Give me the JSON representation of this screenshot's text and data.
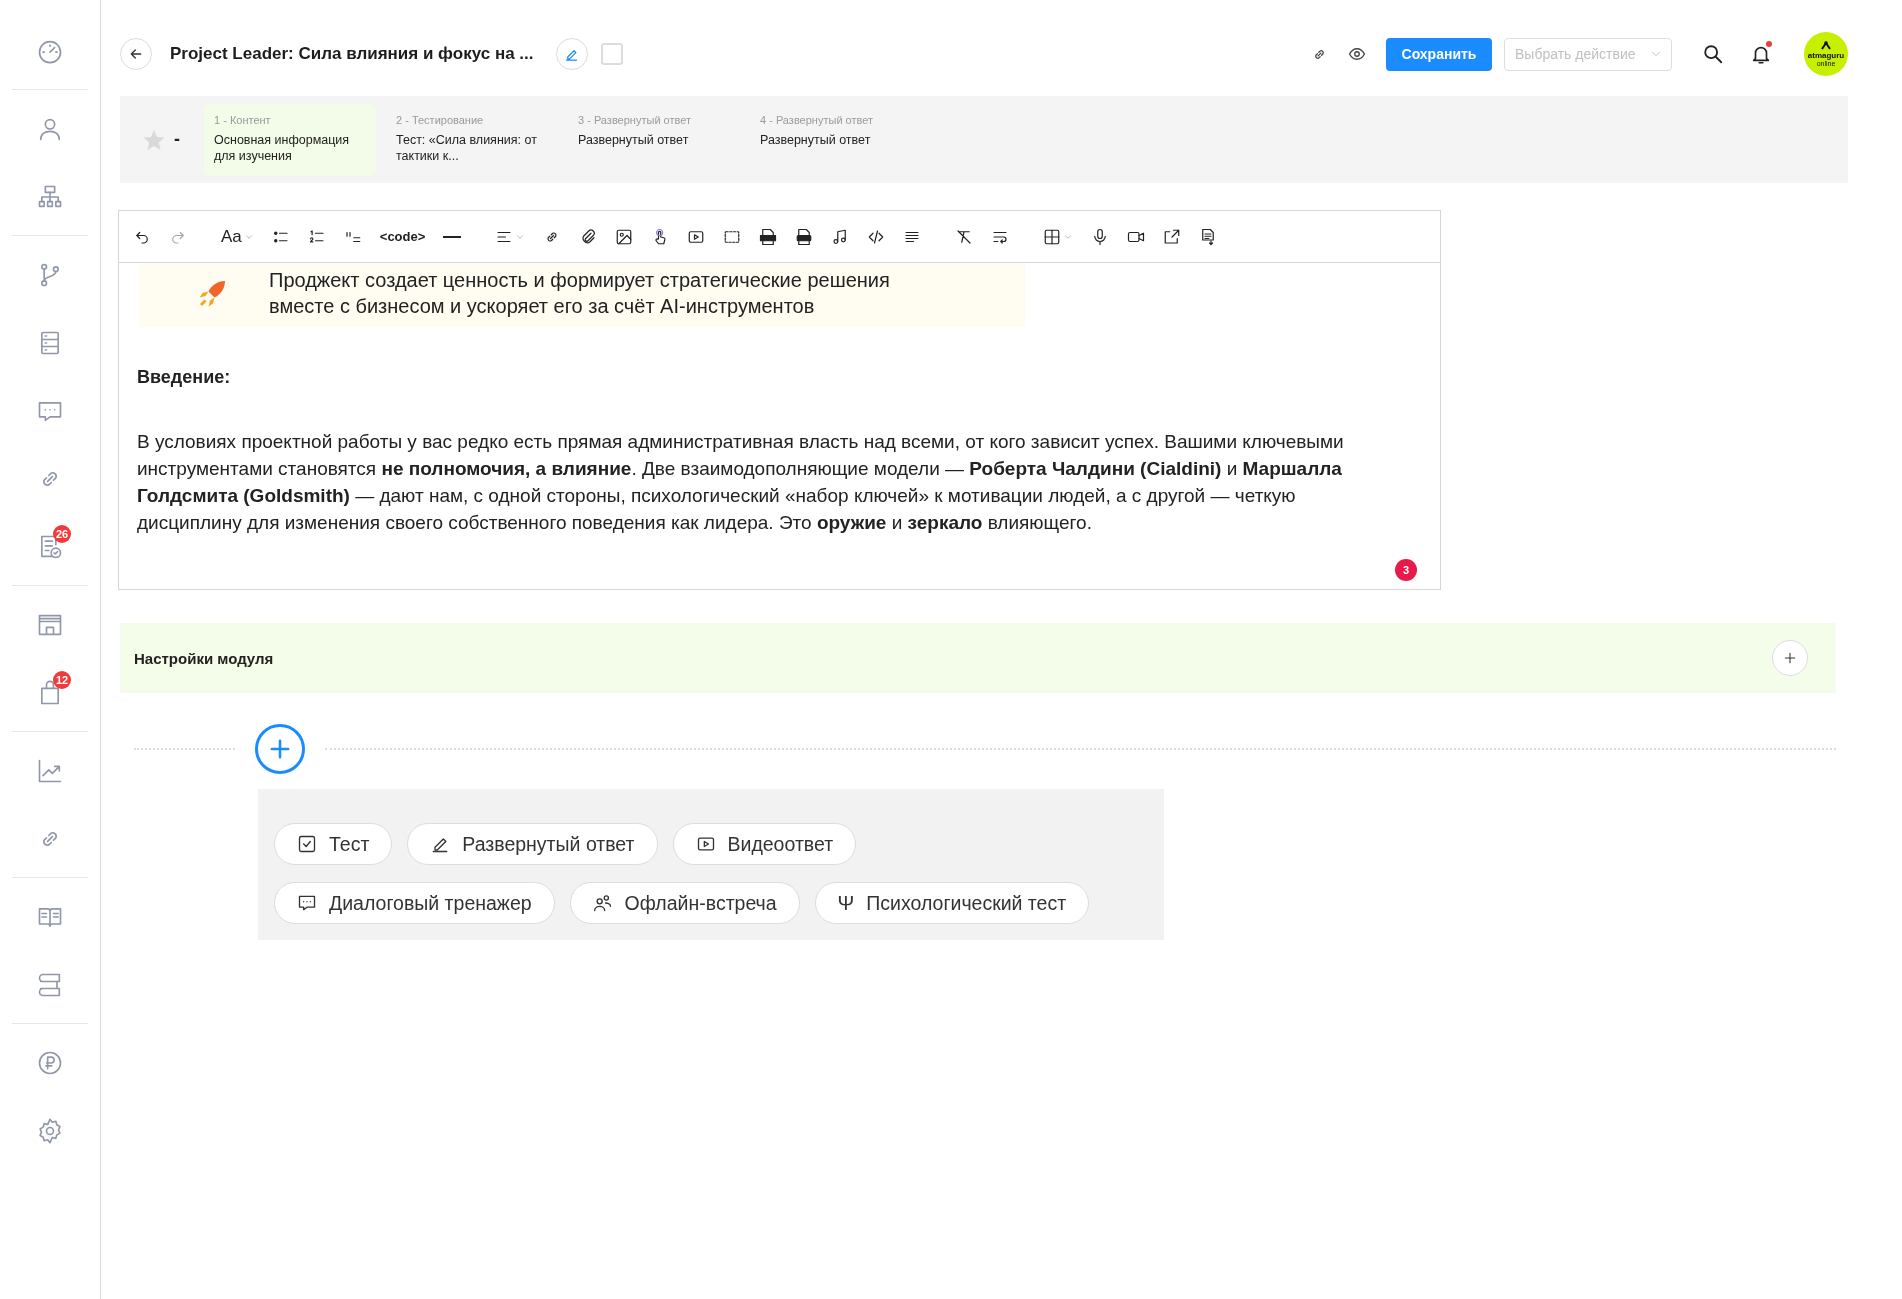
{
  "sidebar": {
    "groups": [
      [
        {
          "kind": "dashboard"
        }
      ],
      [
        {
          "kind": "user"
        },
        {
          "kind": "org"
        }
      ],
      [
        {
          "kind": "branch"
        },
        {
          "kind": "list"
        },
        {
          "kind": "chat"
        },
        {
          "kind": "link"
        },
        {
          "kind": "tasks",
          "badge": "26"
        }
      ],
      [
        {
          "kind": "store"
        },
        {
          "kind": "bag",
          "badge": "12"
        }
      ],
      [
        {
          "kind": "chart"
        },
        {
          "kind": "link"
        }
      ],
      [
        {
          "kind": "book"
        },
        {
          "kind": "stack"
        }
      ],
      [
        {
          "kind": "ruble"
        },
        {
          "kind": "settings"
        }
      ]
    ]
  },
  "header": {
    "title": "Project Leader: Сила влияния и фокус на ...",
    "checkbox": {
      "checked": false
    },
    "save_button": "Сохранить",
    "action_select": {
      "placeholder": "Выбрать действие"
    },
    "notifications": {
      "unread": true
    },
    "logo": {
      "text": "atmaguru",
      "subtext": "online"
    }
  },
  "steps": {
    "rating": {
      "starred": false,
      "value": "-"
    },
    "items": [
      {
        "label": "1 - Контент",
        "title": "Основная информация для изучения",
        "selected": true
      },
      {
        "label": "2 - Тестирование",
        "title": "Тест: «Сила влияния: от тактики к...",
        "selected": false
      },
      {
        "label": "3 - Развернутый ответ",
        "title": "Развернутый ответ",
        "selected": false
      },
      {
        "label": "4 - Развернутый ответ",
        "title": "Развернутый ответ",
        "selected": false
      }
    ]
  },
  "editor": {
    "toolbar": {
      "groups": [
        [
          {
            "kind": "undo",
            "disabled": false
          },
          {
            "kind": "redo",
            "disabled": true
          }
        ],
        [
          {
            "kind": "font",
            "label": "Aa",
            "disabled": false
          },
          {
            "kind": "bullets",
            "disabled": false
          },
          {
            "kind": "numbered",
            "disabled": false
          },
          {
            "kind": "quote",
            "disabled": false
          },
          {
            "kind": "code",
            "label": "<code>",
            "disabled": false
          },
          {
            "kind": "hr",
            "disabled": false
          }
        ],
        [
          {
            "kind": "align",
            "disabled": false
          },
          {
            "kind": "link",
            "disabled": false
          },
          {
            "kind": "clip",
            "disabled": false
          },
          {
            "kind": "image",
            "disabled": false
          },
          {
            "kind": "touch",
            "disabled": false
          },
          {
            "kind": "video",
            "disabled": false
          },
          {
            "kind": "select",
            "disabled": false
          },
          {
            "kind": "pptx",
            "disabled": false
          },
          {
            "kind": "pdf",
            "disabled": false
          },
          {
            "kind": "music",
            "disabled": false
          },
          {
            "kind": "embed",
            "disabled": false
          },
          {
            "kind": "more",
            "disabled": false
          }
        ],
        [
          {
            "kind": "clear",
            "disabled": false
          },
          {
            "kind": "wrap",
            "disabled": false
          }
        ],
        [
          {
            "kind": "table",
            "disabled": false
          },
          {
            "kind": "mic",
            "disabled": false
          },
          {
            "kind": "camera",
            "disabled": false
          },
          {
            "kind": "export",
            "disabled": false
          },
          {
            "kind": "doc",
            "disabled": false
          }
        ]
      ]
    },
    "content": {
      "callout": "Проджект создает ценность и формирует стратегические решения вместе с бизнесом и ускоряет его за счёт AI-инструментов",
      "heading": "Введение:",
      "paragraph": "В условиях проектной работы у вас редко есть прямая административная власть над всеми, от кого зависит успех. Вашими ключевыми инструментами становятся **не полномочия, а влияние**. Две взаимодополняющие модели — **Роберта Чалдини (Cialdini)** и **Маршалла Голдсмита (Goldsmith)** — дают нам, с одной стороны, психологический «набор ключей» к мотивации людей, а с другой — четкую дисциплину для изменения своего собственного поведения как лидера. Это **оружие** и **зеркало** влияющего."
    },
    "comments_badge": "3"
  },
  "module_settings": {
    "title": "Настройки модуля"
  },
  "add_block": {
    "rows": [
      [
        {
          "kind": "test",
          "label": "Тест"
        },
        {
          "kind": "essay",
          "label": "Развернутый ответ"
        },
        {
          "kind": "video",
          "label": "Видеоответ"
        }
      ],
      [
        {
          "kind": "dialog",
          "label": "Диалоговый тренажер"
        },
        {
          "kind": "meeting",
          "label": "Офлайн-встреча"
        },
        {
          "kind": "psych",
          "icon": "Ψ",
          "label": "Психологический тест"
        }
      ]
    ]
  }
}
